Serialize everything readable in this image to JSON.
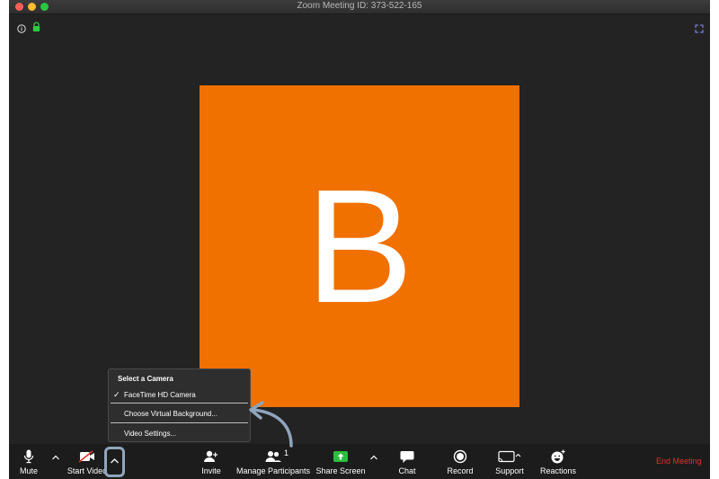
{
  "window": {
    "title": "Zoom Meeting ID: 373-522-165"
  },
  "video": {
    "avatar_letter": "B",
    "tile_color": "#f07000"
  },
  "camera_menu": {
    "header": "Select a Camera",
    "items": [
      {
        "label": "FaceTime HD Camera",
        "checked": true
      },
      {
        "label": "Choose Virtual Background..."
      },
      {
        "label": "Video Settings..."
      }
    ]
  },
  "toolbar": {
    "mute_label": "Mute",
    "start_video_label": "Start Video",
    "invite_label": "Invite",
    "manage_participants_label": "Manage Participants",
    "participant_count": "1",
    "share_screen_label": "Share Screen",
    "chat_label": "Chat",
    "record_label": "Record",
    "support_label": "Support",
    "reactions_label": "Reactions",
    "end_meeting_label": "End Meeting",
    "end_meeting_color": "#e0332d",
    "share_screen_color": "#2dbd3c"
  },
  "icons": [
    "info-icon",
    "lock-icon",
    "fullscreen-icon",
    "microphone-icon",
    "video-off-icon",
    "caret-up-icon",
    "invite-icon",
    "participants-icon",
    "share-screen-icon",
    "chat-icon",
    "record-icon",
    "support-icon",
    "reactions-icon",
    "check-icon",
    "annotation-arrow"
  ]
}
